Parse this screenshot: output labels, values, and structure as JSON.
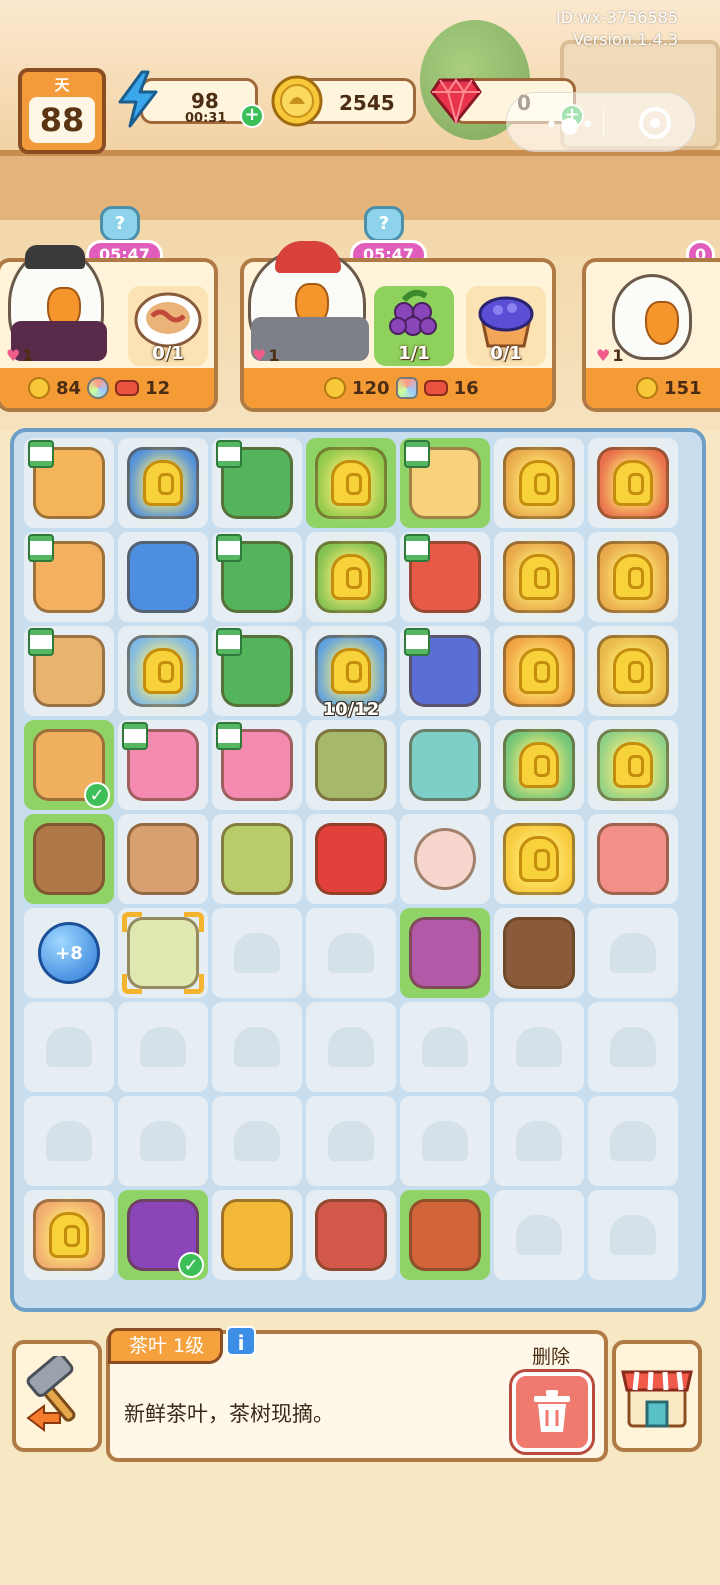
{
  "debug": {
    "id_text": "ID:wx-3756585",
    "version_text": "Version:1.4.3"
  },
  "hud": {
    "day_label": "天",
    "day_value": "88",
    "energy": {
      "value": "98",
      "timer": "00:31"
    },
    "coins": {
      "value": "2545"
    },
    "gems": {
      "value": "0"
    }
  },
  "customers": [
    {
      "timer": "05:47",
      "hearts": "1",
      "orders": [
        {
          "item": "bacon-toast",
          "count": "0/1",
          "done": false
        }
      ],
      "reward_coins": "84",
      "reward_gem": "",
      "reward_tags": "12"
    },
    {
      "timer": "05:47",
      "hearts": "1",
      "orders": [
        {
          "item": "grapes",
          "count": "1/1",
          "done": true
        },
        {
          "item": "blueberry-muffin",
          "count": "0/1",
          "done": false
        }
      ],
      "reward_coins": "120",
      "reward_tags": "16"
    },
    {
      "timer": "0",
      "hearts": "1",
      "orders": [],
      "reward_coins": "151"
    }
  ],
  "board": {
    "rows": [
      [
        "cutting-board-generator",
        "blue-oven-locked",
        "green-stove-generator",
        "fruit-basket-locked",
        "blender-generator",
        "canister-locked",
        "red-bag-locked"
      ],
      [
        "knife-table-generator",
        "blue-oven",
        "green-stove-generator",
        "salad-bowl-locked",
        "red-toaster-generator",
        "canister-locked",
        "pot-locked"
      ],
      [
        "knife-board-generator",
        "ice-oven-locked",
        "green-stove-generator",
        "fridge-locked",
        "blue-oven-generator",
        "vegetable-crate-locked",
        "basket-locked"
      ],
      [
        "tea-cup",
        "pink-oven-generator",
        "pink-oven-generator",
        "fish",
        "shrimp",
        "jar-locked",
        "bottle-locked"
      ],
      [
        "coffee-cup",
        "iced-tea",
        "herb-bag",
        "cola-can",
        "egg",
        "corn-locked",
        "squid"
      ],
      [
        "energy-bubble",
        "tea-leaf",
        "",
        "",
        "onion",
        "mushroom",
        ""
      ],
      [
        "",
        "",
        "",
        "",
        "",
        "",
        ""
      ],
      [
        "",
        "",
        "",
        "",
        "",
        "",
        ""
      ],
      [
        "box-locked",
        "grapes",
        "honey-spoon",
        "bacon",
        "sausage",
        "",
        ""
      ]
    ],
    "fridge_progress": "10/12",
    "energy_bubble_label": "+8",
    "selected_cell": "tea-leaf"
  },
  "selected_item": {
    "title": "茶叶 1级",
    "info_icon": "i",
    "description": "新鲜茶叶，茶树现摘。",
    "delete_label": "删除"
  },
  "colors": {
    "accent": "#f59b36",
    "border": "#b07a45",
    "highlight": "#8fd366",
    "board": "#c8ddee"
  }
}
